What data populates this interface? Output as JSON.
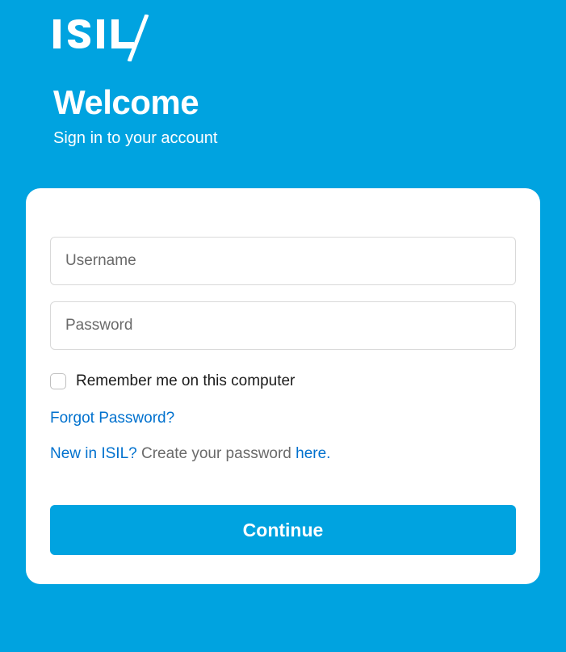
{
  "brand": {
    "name": "ISIL"
  },
  "header": {
    "title": "Welcome",
    "subtitle": "Sign in to your account"
  },
  "form": {
    "username_placeholder": "Username",
    "username_value": "",
    "password_placeholder": "Password",
    "password_value": "",
    "remember_label": "Remember me on this computer",
    "forgot_label": "Forgot Password?",
    "new_prefix": "New in ISIL?",
    "new_middle": " Create your password ",
    "new_link": "here.",
    "continue_label": "Continue"
  },
  "colors": {
    "brand_blue": "#00a3e0",
    "link_blue": "#0071ce"
  }
}
